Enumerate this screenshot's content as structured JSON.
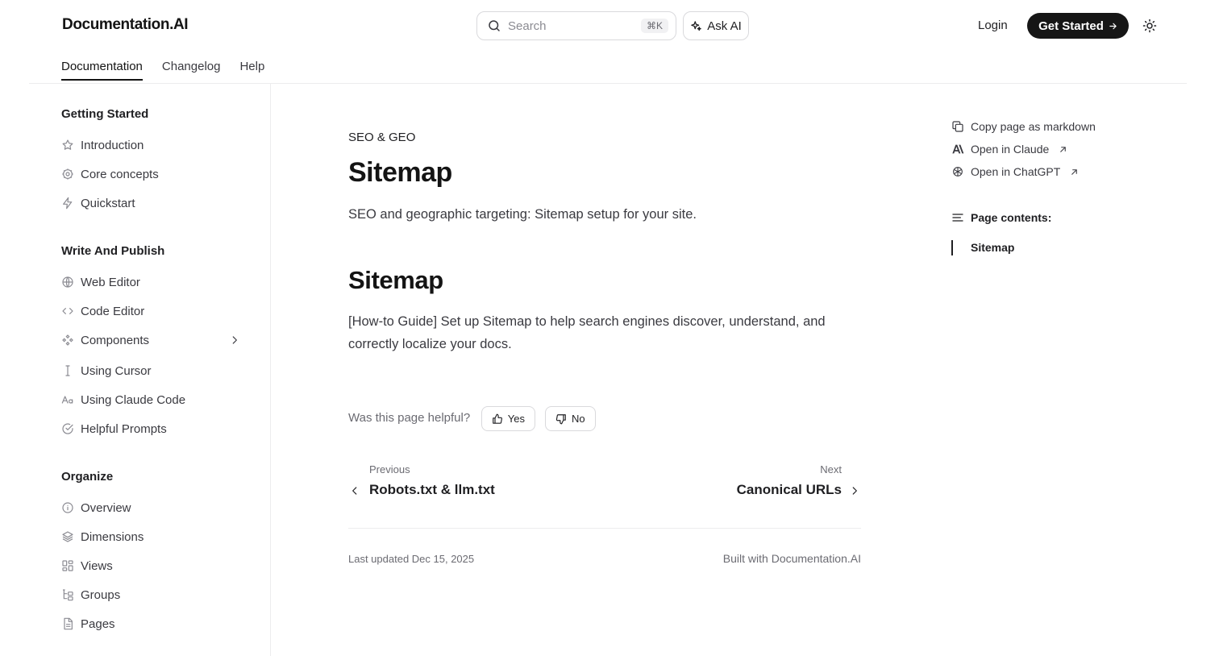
{
  "header": {
    "logo": "Documentation.AI",
    "search_placeholder": "Search",
    "search_shortcut": "⌘K",
    "ask_ai": "Ask AI",
    "login": "Login",
    "get_started": "Get Started"
  },
  "tabs": [
    {
      "label": "Documentation",
      "active": true
    },
    {
      "label": "Changelog",
      "active": false
    },
    {
      "label": "Help",
      "active": false
    }
  ],
  "sidebar": {
    "sections": [
      {
        "title": "Getting Started",
        "items": [
          {
            "label": "Introduction",
            "icon": "star-icon"
          },
          {
            "label": "Core concepts",
            "icon": "gear-icon"
          },
          {
            "label": "Quickstart",
            "icon": "bolt-icon"
          }
        ]
      },
      {
        "title": "Write And Publish",
        "items": [
          {
            "label": "Web Editor",
            "icon": "globe-icon"
          },
          {
            "label": "Code Editor",
            "icon": "code-icon"
          },
          {
            "label": "Components",
            "icon": "components-icon",
            "expandable": true
          },
          {
            "label": "Using Cursor",
            "icon": "text-cursor-icon"
          },
          {
            "label": "Using Claude Code",
            "icon": "font-icon"
          },
          {
            "label": "Helpful Prompts",
            "icon": "check-circle-icon"
          }
        ]
      },
      {
        "title": "Organize",
        "items": [
          {
            "label": "Overview",
            "icon": "info-icon"
          },
          {
            "label": "Dimensions",
            "icon": "layers-icon"
          },
          {
            "label": "Views",
            "icon": "grid-icon"
          },
          {
            "label": "Groups",
            "icon": "tree-icon"
          },
          {
            "label": "Pages",
            "icon": "file-icon"
          }
        ]
      }
    ]
  },
  "main": {
    "eyebrow": "SEO & GEO",
    "title": "Sitemap",
    "lede": "SEO and geographic targeting: Sitemap setup for your site.",
    "section_title": "Sitemap",
    "section_body": "[How-to Guide] Set up Sitemap to help search engines discover, understand, and correctly localize your docs.",
    "feedback": {
      "question": "Was this page helpful?",
      "yes": "Yes",
      "no": "No"
    },
    "prev": {
      "label": "Previous",
      "title": "Robots.txt & llm.txt"
    },
    "next": {
      "label": "Next",
      "title": "Canonical URLs"
    },
    "last_updated": "Last updated Dec 15, 2025",
    "built_with": "Built with Documentation.AI"
  },
  "rail": {
    "copy_markdown": "Copy page as markdown",
    "open_claude": "Open in Claude",
    "open_chatgpt": "Open in ChatGPT",
    "page_contents": "Page contents:",
    "toc": [
      "Sitemap"
    ]
  }
}
